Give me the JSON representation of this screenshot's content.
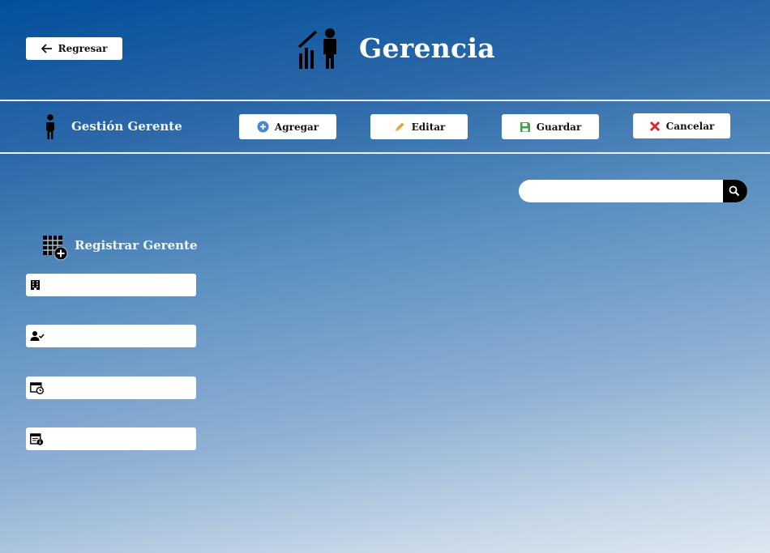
{
  "header": {
    "back_label": "Regresar",
    "title": "Gerencia"
  },
  "toolbar": {
    "section_label": "Gestión Gerente",
    "add_label": "Agregar",
    "edit_label": "Editar",
    "save_label": "Guardar",
    "cancel_label": "Cancelar"
  },
  "search": {
    "placeholder": ""
  },
  "form": {
    "title": "Registrar Gerente",
    "fields": [
      {
        "icon": "building-icon",
        "value": ""
      },
      {
        "icon": "user-check-icon",
        "value": ""
      },
      {
        "icon": "calendar-clock-icon",
        "value": ""
      },
      {
        "icon": "calendar-info-icon",
        "value": ""
      }
    ]
  },
  "colors": {
    "header_blue": "#024f9a",
    "add_icon": "#4a86c8",
    "edit_icon": "#f0a030",
    "save_icon": "#3fa24b",
    "cancel_icon": "#d22b2b"
  }
}
